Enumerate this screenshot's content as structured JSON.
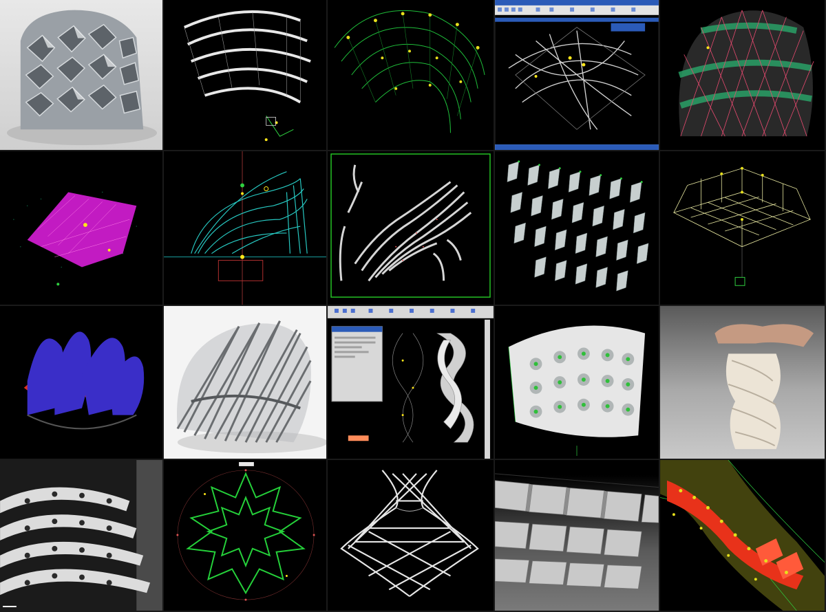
{
  "tiles": [
    {
      "name": "faceted-pavilion-render",
      "colors": {
        "bg": "#e4e4e4",
        "fg": "#8a9096"
      }
    },
    {
      "name": "ribbon-shell-wireframe",
      "colors": {
        "bg": "#000000",
        "fg": "#e0e0e0"
      }
    },
    {
      "name": "green-arch-grid",
      "colors": {
        "bg": "#000000",
        "fg": "#1fbf3a"
      }
    },
    {
      "name": "software-window-curves",
      "colors": {
        "bg": "#ffffff",
        "fg": "#c0c0c0",
        "titlebar": "#2b5bb8"
      }
    },
    {
      "name": "diagrid-dome-wireframe",
      "colors": {
        "bg": "#000000",
        "fg": "#e94a70",
        "band": "#2aa86a"
      }
    },
    {
      "name": "magenta-surface-grid",
      "colors": {
        "bg": "#000000",
        "fg": "#d01fd0"
      }
    },
    {
      "name": "cyan-curve-network",
      "colors": {
        "bg": "#000000",
        "fg": "#27c9c2"
      }
    },
    {
      "name": "striped-strips-layout",
      "colors": {
        "bg": "#000000",
        "fg": "#d6d6d6",
        "frame": "#25c425"
      }
    },
    {
      "name": "louver-fin-array",
      "colors": {
        "bg": "#000000",
        "fg": "#cfd6d6"
      }
    },
    {
      "name": "box-frame-wireframe",
      "colors": {
        "bg": "#000000",
        "fg": "#e8e8a0"
      }
    },
    {
      "name": "purple-red-petals",
      "colors": {
        "bg": "#000000",
        "fg": "#3a2ec8",
        "accent": "#e0301e"
      }
    },
    {
      "name": "diagrid-shell-render",
      "colors": {
        "bg": "#f2f2f2",
        "fg": "#6a6d70"
      }
    },
    {
      "name": "software-twisted-column",
      "colors": {
        "bg": "#000000",
        "fg": "#d8d8d8",
        "panel": "#d8d8d8"
      }
    },
    {
      "name": "cushion-panel-wall",
      "colors": {
        "bg": "#000000",
        "fg": "#e6e6e6",
        "accent": "#2fbf3a"
      }
    },
    {
      "name": "hand-twisted-model-photo",
      "colors": {
        "bg": "#bdbdbd",
        "fg": "#ece4d6"
      }
    },
    {
      "name": "perforated-ribs-photo",
      "colors": {
        "bg": "#1a1a1a",
        "fg": "#e0e0e0"
      }
    },
    {
      "name": "green-star-lattice",
      "colors": {
        "bg": "#000000",
        "fg": "#25d13a"
      }
    },
    {
      "name": "woven-vase-lattice",
      "colors": {
        "bg": "#000000",
        "fg": "#e6e6e6"
      }
    },
    {
      "name": "folded-panel-facade",
      "colors": {
        "bg": "#3c3c3c",
        "fg": "#d2d2d2"
      }
    },
    {
      "name": "red-yellow-flow-surface",
      "colors": {
        "bg": "#000000",
        "fg": "#e8321a",
        "accent": "#e6e01c"
      }
    }
  ]
}
